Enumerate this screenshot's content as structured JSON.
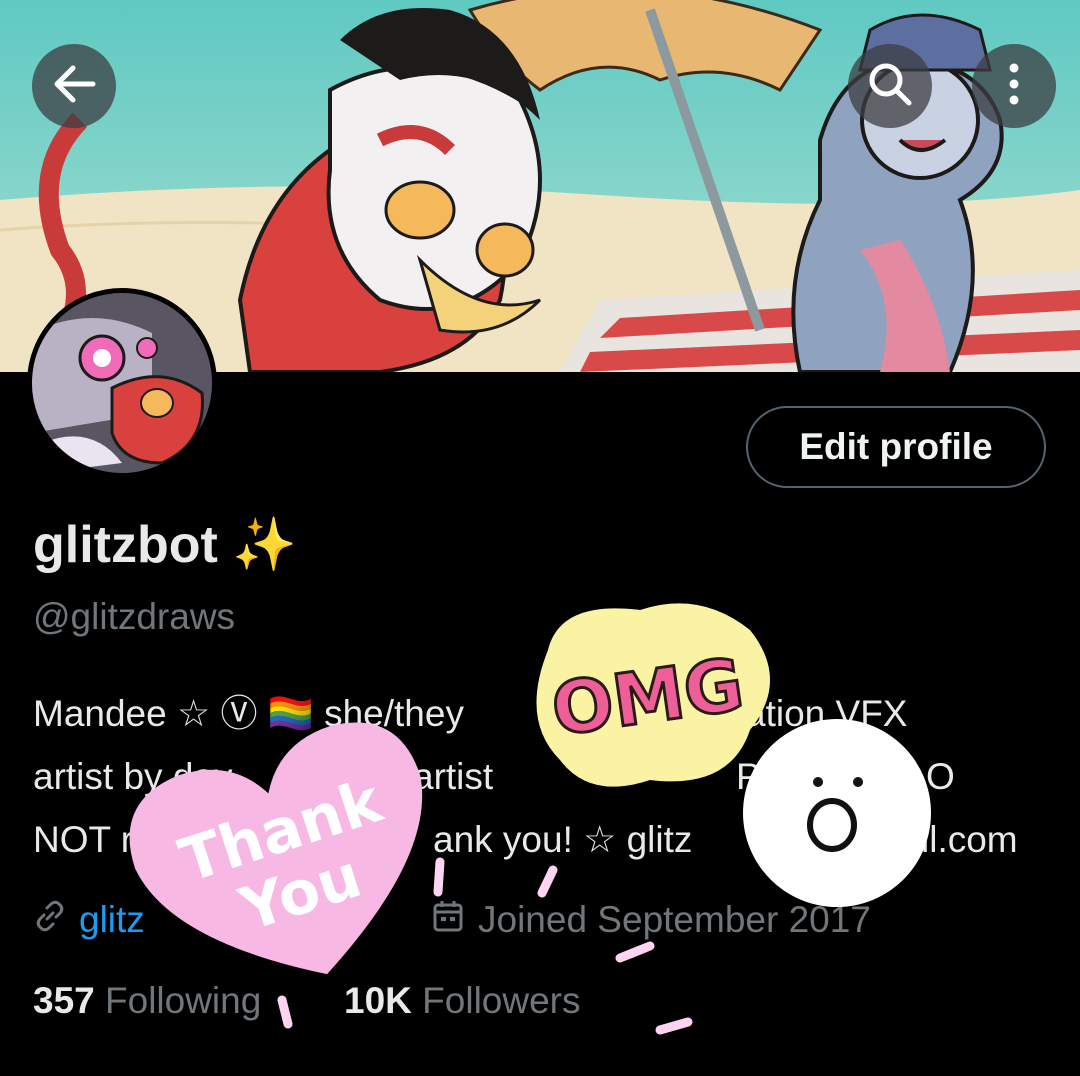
{
  "nav": {
    "back_icon": "arrow-left-icon",
    "search_icon": "search-icon",
    "more_icon": "more-vertical-icon"
  },
  "profile": {
    "display_name": "glitzbot",
    "name_emoji": "✨",
    "handle": "@glitzdraws",
    "edit_button": "Edit profile",
    "bio_lines": [
      "Mandee ☆ Ⓥ 🏳️‍🌈 she/they",
      "artist by day",
      "NOT re"
    ],
    "bio_fragments": {
      "line1_right": "ation VFX",
      "line2_mid": "artist",
      "line2_right": "P",
      "line2_far": "O",
      "line3_mid": "ank you! ☆ glitz",
      "line3_right": "il.com"
    },
    "link_text": "glitz",
    "link_icon": "link-icon",
    "joined_icon": "calendar-icon",
    "joined": "Joined September 2017",
    "following_count": "357",
    "following_label": "Following",
    "followers_count": "10K",
    "followers_label": "Followers"
  },
  "stickers": {
    "omg_text": "OMG",
    "thank_you_line1": "Thank",
    "thank_you_line2": "You"
  },
  "colors": {
    "background": "#000000",
    "text_primary": "#e7e9ea",
    "text_secondary": "#71767b",
    "link": "#1d9bf0",
    "heart_sticker": "#f7b8e4",
    "omg_sticker_bg": "#fbf3a4",
    "omg_sticker_text": "#ef5f97"
  }
}
